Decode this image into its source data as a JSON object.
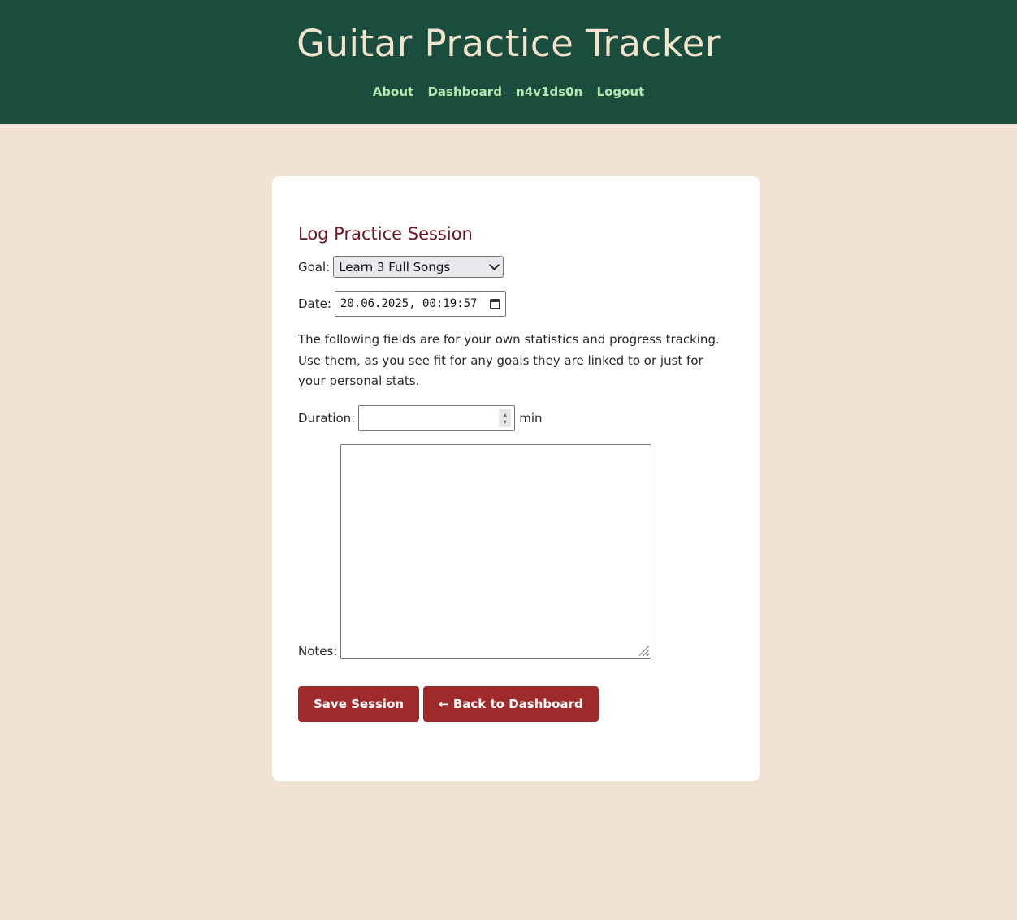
{
  "header": {
    "title": "Guitar Practice Tracker",
    "nav": [
      "About",
      "Dashboard",
      "n4v1ds0n",
      "Logout"
    ]
  },
  "form": {
    "title": "Log Practice Session",
    "goal_label": "Goal:",
    "goal_value": "Learn 3 Full Songs",
    "date_label": "Date:",
    "date_value": "20.06.2025, 00:19:57",
    "info_text": "The following fields are for your own statistics and progress tracking. Use them, as you see fit for any goals they are linked to or just for your personal stats.",
    "duration_label": "Duration:",
    "duration_value": "",
    "duration_unit": "min",
    "notes_label": "Notes:",
    "notes_value": "",
    "save_button": "Save Session",
    "back_button": "← Back to Dashboard"
  },
  "colors": {
    "header_bg": "#1b4d3e",
    "page_bg": "#f0e3d4",
    "title_text": "#f1e3cc",
    "nav_link": "#b8e6b0",
    "form_title": "#6e1423",
    "button_bg": "#9e2a2b"
  }
}
